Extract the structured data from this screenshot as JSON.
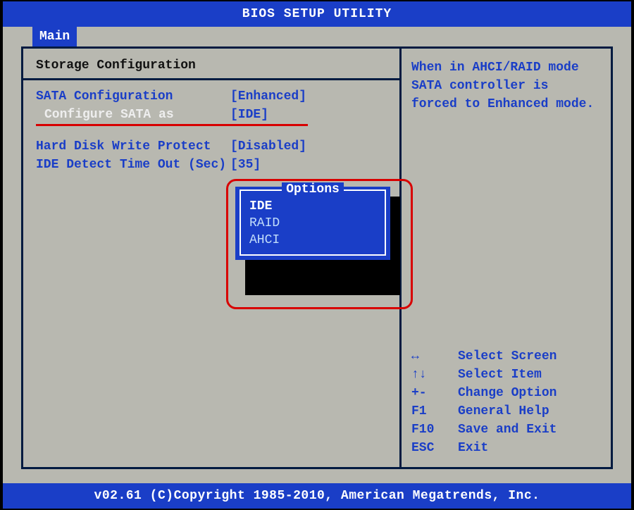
{
  "title": "BIOS SETUP UTILITY",
  "tab": {
    "main": "Main"
  },
  "section_title": "Storage Configuration",
  "settings": {
    "sata_config": {
      "label": "SATA Configuration",
      "value": "[Enhanced]"
    },
    "configure_sata_as": {
      "label": "Configure SATA as",
      "value": "[IDE]"
    },
    "hd_write_protect": {
      "label": "Hard Disk Write Protect",
      "value": "[Disabled]"
    },
    "ide_detect_timeout": {
      "label": "IDE Detect Time Out (Sec)",
      "value": "[35]"
    }
  },
  "popup": {
    "title": "Options",
    "options": [
      "IDE",
      "RAID",
      "AHCI"
    ],
    "selected_index": 0
  },
  "help_text": "When in AHCI/RAID mode SATA controller is forced to Enhanced mode.",
  "key_hints": [
    {
      "key": "↔",
      "desc": "Select Screen"
    },
    {
      "key": "↑↓",
      "desc": "Select Item"
    },
    {
      "key": "+-",
      "desc": "Change Option"
    },
    {
      "key": "F1",
      "desc": "General Help"
    },
    {
      "key": "F10",
      "desc": "Save and Exit"
    },
    {
      "key": "ESC",
      "desc": "Exit"
    }
  ],
  "footer": "v02.61 (C)Copyright 1985-2010, American Megatrends, Inc."
}
